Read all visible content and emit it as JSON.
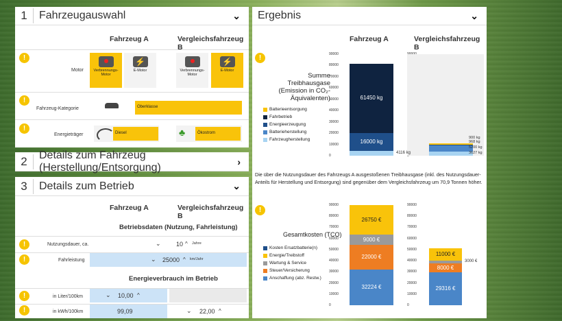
{
  "sec1": {
    "num": "1",
    "title": "Fahrzeugauswahl",
    "colA": "Fahrzeug A",
    "colB": "Vergleichsfahrzeug B",
    "motor_label": "Motor",
    "m1": "Verbrennungs-Motor",
    "m2": "E-Motor",
    "m3": "Verbrennungs-Motor",
    "m4": "E-Motor",
    "kat_label": "Fahrzeug-Kategorie",
    "kat_value": "Oberklasse",
    "energie_label": "Energieträger",
    "energie_a": "Diesel",
    "energie_b": "Ökostrom"
  },
  "sec2": {
    "num": "2",
    "title": "Details zum Fahrzeug (Herstellung/Entsorgung)"
  },
  "sec3": {
    "num": "3",
    "title": "Details zum Betrieb",
    "colA": "Fahrzeug A",
    "colB": "Vergleichsfahrzeug B",
    "betriebsdaten": "Betriebsdaten (Nutzung, Fahrleistung)",
    "nutz_label": "Nutzungsdauer, ca.",
    "nutz_val": "10",
    "nutz_unit": "Jahre",
    "fahr_label": "Fahrleistung",
    "fahr_val": "25000",
    "fahr_unit": "km/Jahr",
    "verbrauch": "Energieverbrauch im Betrieb",
    "liter_label": "in Liter/100km",
    "liter_val": "10,00",
    "kwh_label": "in kWh/100km",
    "kwh_a": "99,09",
    "kwh_b": "22,00"
  },
  "ergebnis": {
    "title": "Ergebnis",
    "colA": "Fahrzeug A",
    "colB": "Vergleichsfahrzeug B",
    "c1_title_1": "Summe",
    "c1_title_2": "Treibhausgase",
    "c1_title_3": "(Emission in CO₂-",
    "c1_title_4": "Äquivalenten)",
    "legend1": [
      "Batterieentsorgung",
      "Fahrbetrieb",
      "Energieerzeugung",
      "Batterieherstellung",
      "Fahrzeugherstellung"
    ],
    "text": "Die über die Nutzungsdauer des Fahrzeugs A ausgestoßenen Treibhausgase (inkl. des Nutzungsdauer-Anteils für Herstellung und Entsorgung) sind gegenüber dem Vergleichsfahrzeug um 70,9 Tonnen höher.",
    "c2_title": "Gesamtkosten (TCO)",
    "legend2": [
      "Kosten Ersatzbatterie(n)",
      "Energie/Treibstoff",
      "Wartung & Service",
      "Steuer/Versicherung",
      "Anschaffung (abz. Restw.)"
    ]
  },
  "chart_data": [
    {
      "type": "bar",
      "title": "Summe Treibhausgase (Emission in CO₂-Äquivalenten)",
      "ylim": [
        0,
        90000
      ],
      "yticks": [
        "90000",
        "80000",
        "70000",
        "60000",
        "50000",
        "40000",
        "30000",
        "20000",
        "10000",
        "0"
      ],
      "categories": [
        "Fahrzeug A",
        "Vergleichsfahrzeug B"
      ],
      "series": [
        {
          "name": "Fahrzeugherstellung",
          "values": [
            4116,
            3627
          ]
        },
        {
          "name": "Batterieherstellung",
          "values": [
            0,
            5200
          ]
        },
        {
          "name": "Energieerzeugung",
          "values": [
            16000,
            968
          ]
        },
        {
          "name": "Fahrbetrieb",
          "values": [
            61450,
            900
          ]
        },
        {
          "name": "Batterieentsorgung",
          "values": [
            0,
            0
          ]
        }
      ],
      "labels": {
        "a": [
          "4116 kg",
          "16000 kg",
          "61450 kg"
        ],
        "b": [
          "3627 kg",
          "5200 kg",
          "968 kg",
          "900 kg"
        ]
      }
    },
    {
      "type": "bar",
      "title": "Gesamtkosten (TCO)",
      "ylim": [
        0,
        90000
      ],
      "yticks": [
        "90000",
        "80000",
        "70000",
        "60000",
        "50000",
        "40000",
        "30000",
        "20000",
        "10000",
        "0"
      ],
      "categories": [
        "Fahrzeug A",
        "Vergleichsfahrzeug B"
      ],
      "series": [
        {
          "name": "Anschaffung (abz. Restw.)",
          "values": [
            32224,
            29316
          ]
        },
        {
          "name": "Steuer/Versicherung",
          "values": [
            22000,
            8000
          ]
        },
        {
          "name": "Wartung & Service",
          "values": [
            9000,
            3000
          ]
        },
        {
          "name": "Energie/Treibstoff",
          "values": [
            26750,
            11000
          ]
        }
      ],
      "labels": {
        "a": [
          "32224 €",
          "22000 €",
          "9000 €",
          "26750 €"
        ],
        "b": [
          "29316 €",
          "8000 €",
          "3000 €",
          "11000 €"
        ]
      }
    }
  ],
  "colors": {
    "dark": "#0f2340",
    "mid": "#1f4f8a",
    "light": "#a8d4f2",
    "blue2": "#4a86c8",
    "yellow": "#f9c30a",
    "gray": "#9a9a9a",
    "orange": "#ee7d22"
  }
}
